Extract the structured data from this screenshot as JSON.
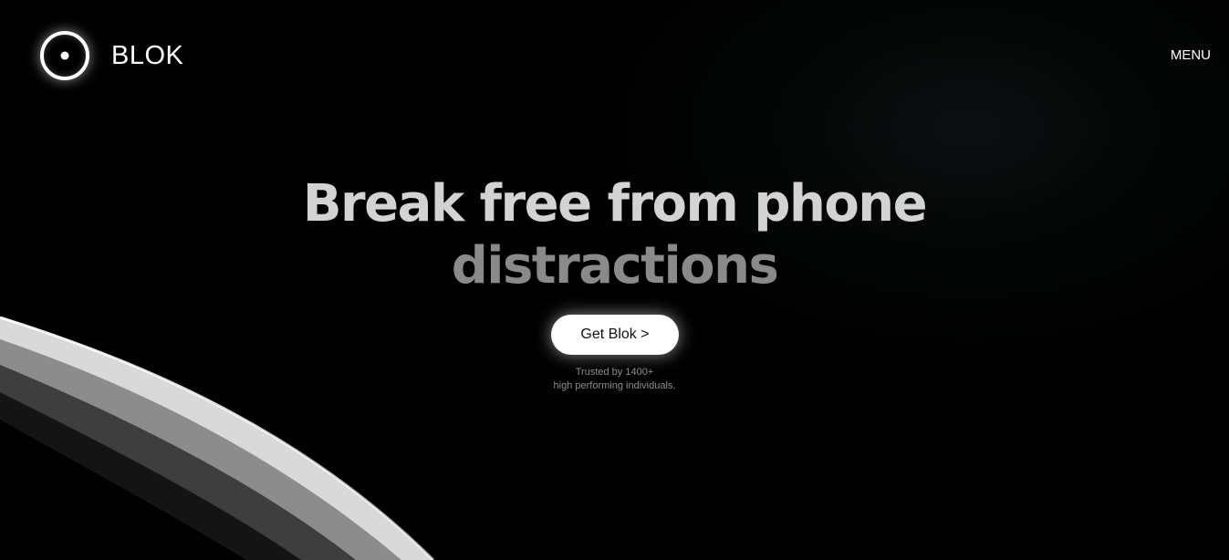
{
  "header": {
    "brand": "BLOK",
    "menu_label": "MENU"
  },
  "hero": {
    "headline_line1": "Break free from phone",
    "headline_line2": "distractions",
    "cta_label": "Get Blok >",
    "trusted_line1": "Trusted by 1400+",
    "trusted_line2": "high performing individuals."
  },
  "colors": {
    "background": "#000000",
    "headline_primary": "#d3d3d3",
    "headline_secondary": "#8a8a8a",
    "cta_background": "#ffffff",
    "cta_text": "#111111"
  },
  "icons": {
    "logo": "ring-with-dot-icon"
  }
}
